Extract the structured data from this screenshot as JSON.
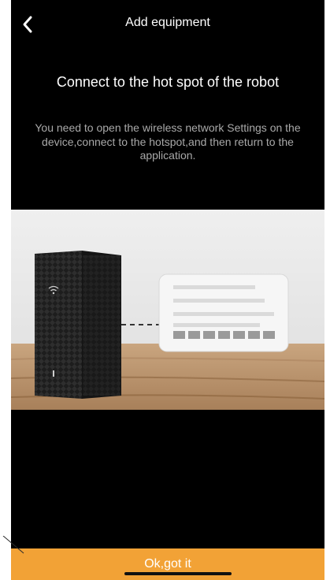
{
  "header": {
    "title": "Add equipment",
    "back_icon": "chevron-left-icon"
  },
  "main": {
    "headline": "Connect to the hot spot of the robot",
    "description": "You need to open the wireless network Settings on the device,connect to the hotspot,and then return to the application.",
    "illustration": {
      "subject": "device-with-wifi-connection-card",
      "icons": [
        "wifi-icon"
      ]
    }
  },
  "footer": {
    "confirm_label": "Ok,got it"
  },
  "colors": {
    "background": "#000000",
    "text_primary": "#ffffff",
    "text_secondary": "#a9a9a9",
    "accent": "#f2a236"
  }
}
